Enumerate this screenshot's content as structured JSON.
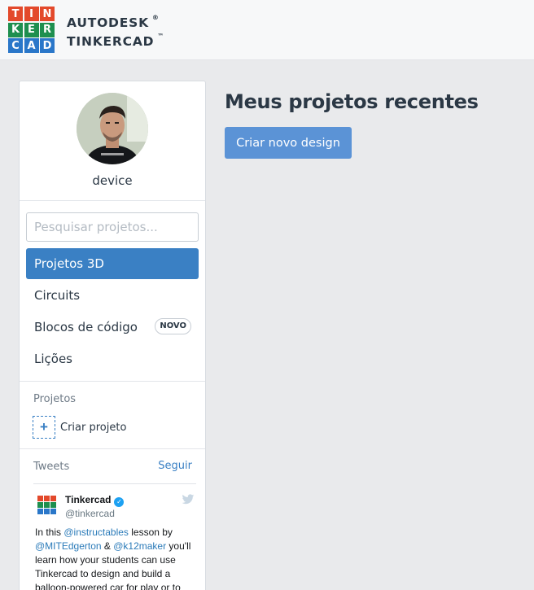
{
  "brand": {
    "logo_letters": [
      "T",
      "I",
      "N",
      "K",
      "E",
      "R",
      "C",
      "A",
      "D"
    ],
    "logo_colors": [
      "#e3492b",
      "#e3492b",
      "#e3492b",
      "#1e8f4f",
      "#1e8f4f",
      "#1e8f4f",
      "#2a77c9",
      "#2a77c9",
      "#2a77c9"
    ],
    "line1": "AUTODESK",
    "line1_mark": "®",
    "line2": "TINKERCAD",
    "line2_mark": "™"
  },
  "sidebar": {
    "username": "device",
    "search_placeholder": "Pesquisar projetos...",
    "nav": [
      {
        "label": "Projetos 3D",
        "active": true
      },
      {
        "label": "Circuits",
        "active": false
      },
      {
        "label": "Blocos de código",
        "active": false,
        "badge": "NOVO"
      },
      {
        "label": "Lições",
        "active": false
      }
    ],
    "projects_label": "Projetos",
    "create_project_label": "Criar projeto",
    "tweets_label": "Tweets",
    "follow_label": "Seguir"
  },
  "tweet": {
    "name": "Tinkercad",
    "handle": "@tinkercad",
    "text_parts": [
      {
        "t": "In this "
      },
      {
        "t": "@instructables",
        "mention": true
      },
      {
        "t": " lesson by "
      },
      {
        "t": "@MITEdgerton",
        "mention": true
      },
      {
        "t": " & "
      },
      {
        "t": "@k12maker",
        "mention": true
      },
      {
        "t": " you'll learn how your students can use Tinkercad to design and build a balloon-powered car for play or to"
      }
    ]
  },
  "main": {
    "title": "Meus projetos recentes",
    "new_design_label": "Criar novo design"
  },
  "colors": {
    "accent": "#3a80c4",
    "button": "#5b93d6",
    "mention": "#2b7bb9",
    "verified": "#1da1f2"
  }
}
